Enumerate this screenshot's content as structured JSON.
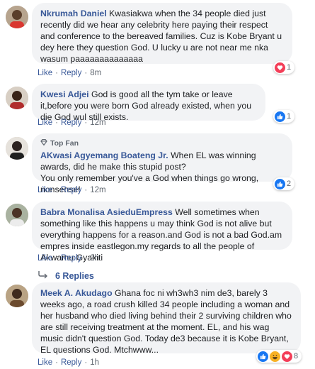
{
  "comments": [
    {
      "author": "Nkrumah Daniel",
      "text": "Kwasiakwa when the 34 people died just recently did we hear any celebrity here paying their respect and conference to the bereaved families. Cuz is Kobe Bryant u dey here they question God. U lucky u are not near me nka wasum paaaaaaaaaaaaaa",
      "like": "Like",
      "reply": "Reply",
      "time": "8m",
      "reaction_count": "1",
      "reaction": "love-icon"
    },
    {
      "author": "Kwesi Adjei",
      "text": "God is good all the tym take or leave it,before you were born God already existed, when you die God wul still exists.",
      "like": "Like",
      "reply": "Reply",
      "time": "12m",
      "reaction_count": "1",
      "reaction": "like-icon"
    },
    {
      "badge": "Top Fan",
      "author": "AKwasi Agyemang Boateng Jr.",
      "text": "When EL was winning awards, did he make this stupid post?",
      "text2": "You only remember you've a God when things go wrong, nonsense!",
      "like": "Like",
      "reply": "Reply",
      "time": "12m",
      "reaction_count": "2",
      "reaction": "like-icon"
    },
    {
      "author": "Babra Monalisa AsieduEmpress",
      "text": "Well sometimes when something like this happens u may think God is not alive but everything happens for a reason.and God is not a bad God.am empres inside eastlegon.my regards to all the people of Akwamu Gyakiti",
      "like": "Like",
      "reply": "Reply",
      "time": "2h",
      "replies_label": "6 Replies"
    },
    {
      "author": "Meek A. Akudago",
      "text": "Ghana foc ni wh3wh3 nim de3, barely 3 weeks ago, a road crush killed 34 people including a woman and her husband who died living behind their 2 surviving children who are still receiving treatment at the moment. EL, and his wag music didn't question God. Today de3 because it is Kobe Bryant, EL questions God. Mtchwww...",
      "like": "Like",
      "reply": "Reply",
      "time": "1h",
      "reaction_count": "8",
      "reactions": [
        "like-icon",
        "haha-icon",
        "love-icon"
      ]
    }
  ],
  "colors": {
    "link": "#385898",
    "bubble": "#f2f3f5",
    "meta": "#606770",
    "like_blue": "#1877f2",
    "love_red": "#f33e58",
    "haha_yellow": "#f7b125"
  }
}
